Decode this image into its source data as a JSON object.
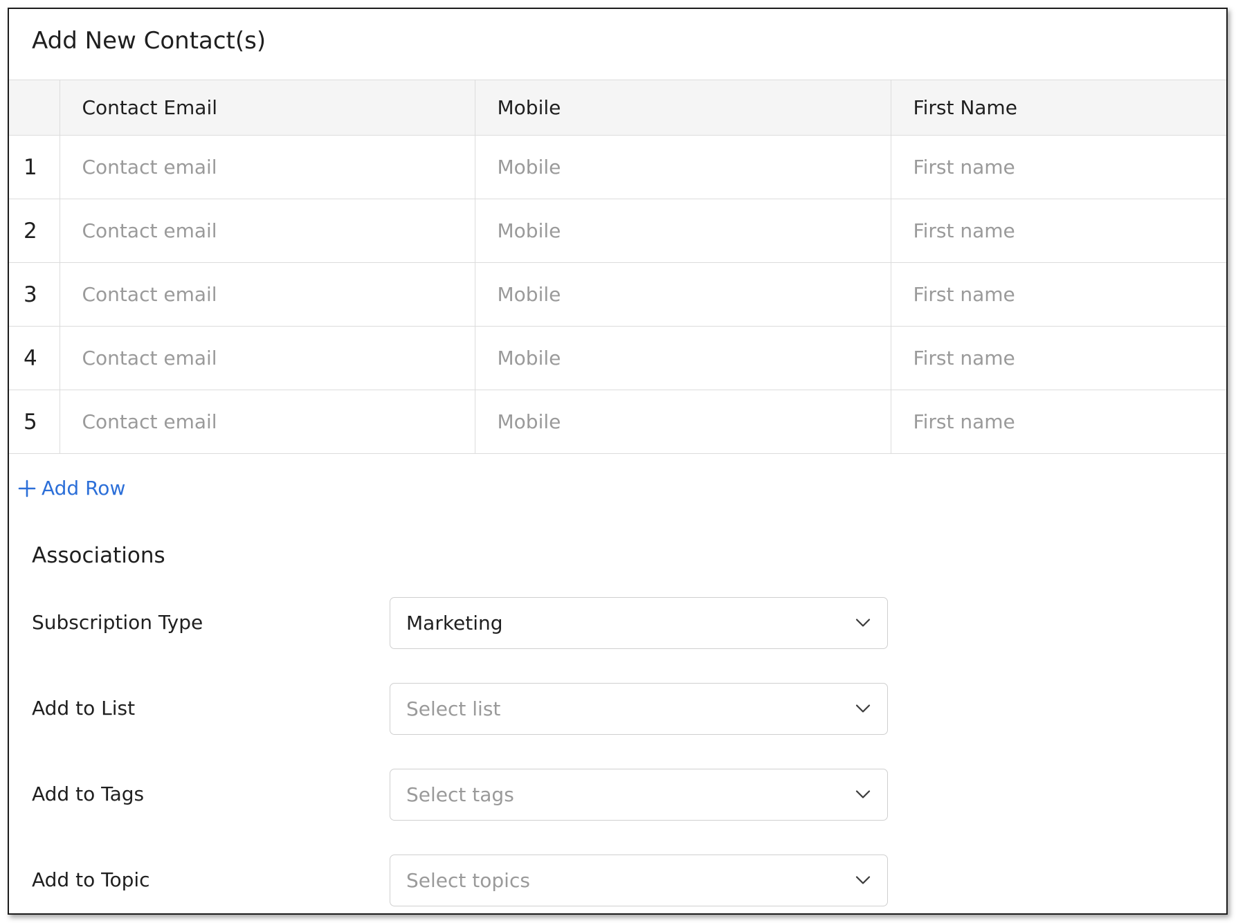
{
  "modal": {
    "title": "Add New Contact(s)"
  },
  "table": {
    "headers": {
      "number": "",
      "email": "Contact Email",
      "mobile": "Mobile",
      "first_name": "First Name"
    },
    "rows": [
      {
        "num": "1",
        "email_placeholder": "Contact email",
        "mobile_placeholder": "Mobile",
        "first_name_placeholder": "First name"
      },
      {
        "num": "2",
        "email_placeholder": "Contact email",
        "mobile_placeholder": "Mobile",
        "first_name_placeholder": "First name"
      },
      {
        "num": "3",
        "email_placeholder": "Contact email",
        "mobile_placeholder": "Mobile",
        "first_name_placeholder": "First name"
      },
      {
        "num": "4",
        "email_placeholder": "Contact email",
        "mobile_placeholder": "Mobile",
        "first_name_placeholder": "First name"
      },
      {
        "num": "5",
        "email_placeholder": "Contact email",
        "mobile_placeholder": "Mobile",
        "first_name_placeholder": "First name"
      }
    ],
    "add_row_label": "Add Row",
    "add_row_icon": "plus-icon"
  },
  "associations": {
    "title": "Associations",
    "fields": [
      {
        "label": "Subscription Type",
        "value": "Marketing",
        "placeholder": "",
        "icon": "chevron-down-icon"
      },
      {
        "label": "Add to List",
        "value": "",
        "placeholder": "Select list",
        "icon": "chevron-down-icon"
      },
      {
        "label": "Add to Tags",
        "value": "",
        "placeholder": "Select tags",
        "icon": "chevron-down-icon"
      },
      {
        "label": "Add to Topic",
        "value": "",
        "placeholder": "Select topics",
        "icon": "chevron-down-icon"
      }
    ]
  },
  "colors": {
    "link": "#2c6fd8",
    "text": "#1f1f1f",
    "placeholder": "#9a9a9a",
    "header_bg": "#f5f5f5",
    "border": "#dcdcdc"
  }
}
